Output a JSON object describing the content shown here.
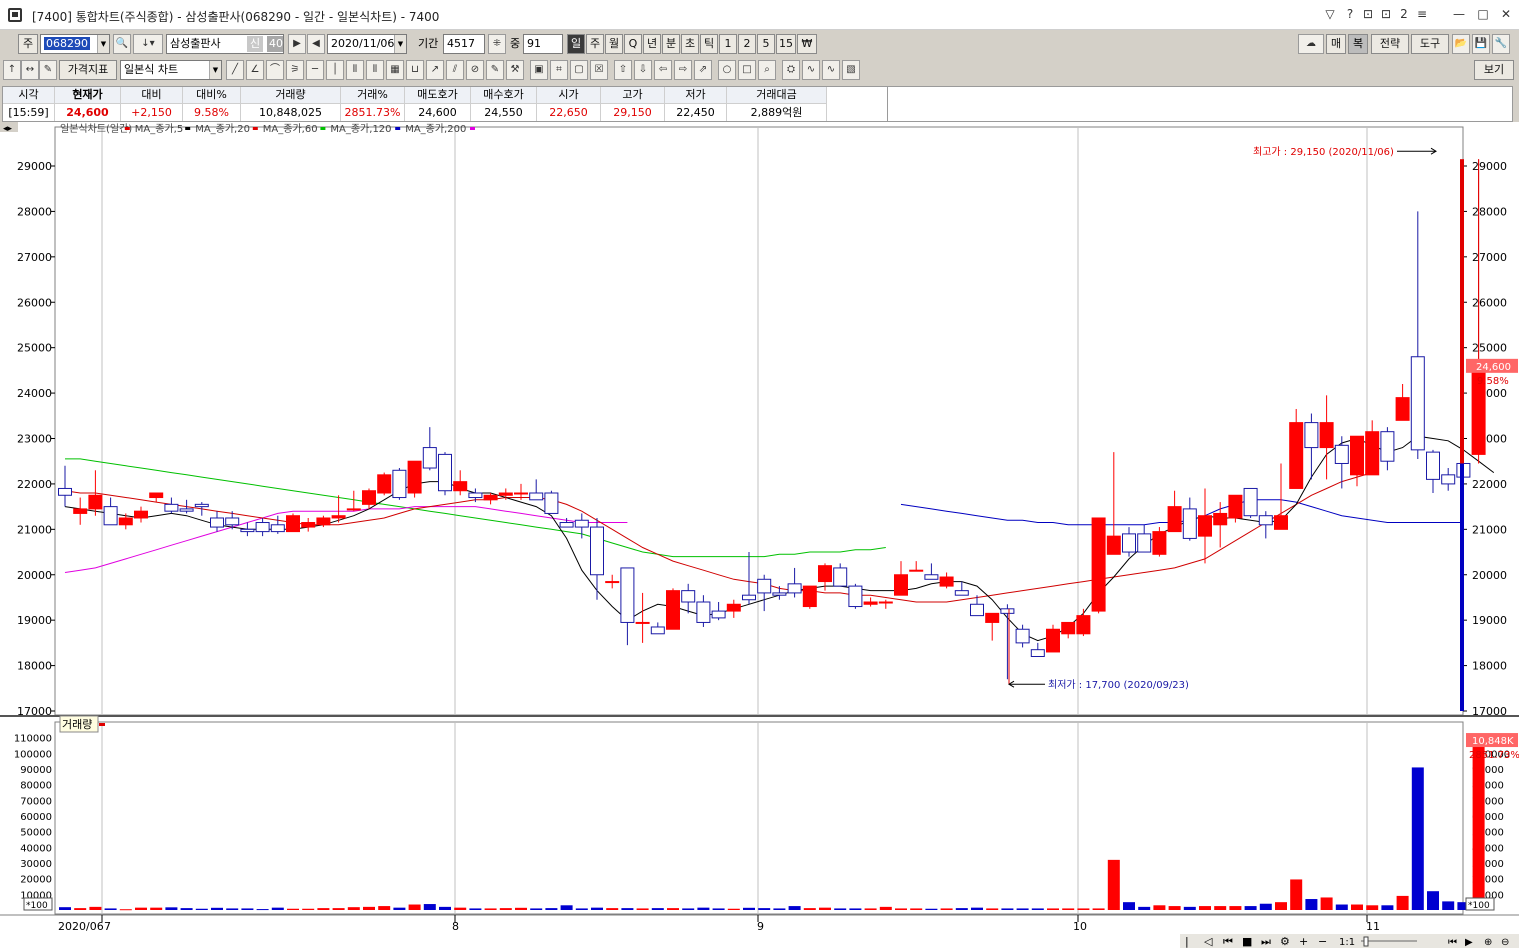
{
  "window": {
    "title": "[7400]  통합차트(주식종합) - 삼성출판사(068290 - 일간 - 일본식차트) - 7400",
    "buttons": [
      "▽",
      "?",
      "⊡",
      "⊡",
      "2",
      "≡",
      "—",
      "□",
      "✕"
    ]
  },
  "toolbar1": {
    "market_label": "주",
    "code": "068290",
    "name": "삼성출판사",
    "badge1": "신",
    "badge2": "40",
    "date": "2020/11/06",
    "period_label": "기간",
    "period_value": "4517",
    "middle_label": "중",
    "middle_value": "91",
    "periods": [
      "일",
      "주",
      "월",
      "Q",
      "년",
      "분",
      "초",
      "틱",
      "1",
      "2",
      "5",
      "15",
      "₩"
    ],
    "right_buttons": [
      "",
      "매",
      "복",
      "전략",
      "도구",
      "",
      "",
      ""
    ]
  },
  "toolbar2": {
    "indicator_label": "가격지표",
    "chart_type": "일본식 차트",
    "view_button": "보기"
  },
  "quote": {
    "columns": [
      {
        "head": "시각",
        "value": "[15:59]",
        "color": "#000000"
      },
      {
        "head": "현재가",
        "value": "24,600",
        "color": "#e00000"
      },
      {
        "head": "대비",
        "value": "+2,150",
        "color": "#e00000"
      },
      {
        "head": "대비%",
        "value": "9.58%",
        "color": "#e00000"
      },
      {
        "head": "거래량",
        "value": "10,848,025",
        "color": "#000000"
      },
      {
        "head": "거래%",
        "value": "2851.73%",
        "color": "#e00000"
      },
      {
        "head": "매도호가",
        "value": "24,600",
        "color": "#000000"
      },
      {
        "head": "매수호가",
        "value": "24,550",
        "color": "#000000"
      },
      {
        "head": "시가",
        "value": "22,650",
        "color": "#e00000"
      },
      {
        "head": "고가",
        "value": "29,150",
        "color": "#e00000"
      },
      {
        "head": "저가",
        "value": "22,450",
        "color": "#000000"
      },
      {
        "head": "거래대금",
        "value": "2,889억원",
        "color": "#000000"
      }
    ]
  },
  "chart_data": {
    "type": "candlestick",
    "legend": [
      "일본식차트(일간)",
      "MA_종가,5",
      "MA_종가,20",
      "MA_종가,60",
      "MA_종가,120",
      "MA_종가,200"
    ],
    "legend_colors": [
      "#e00000",
      "#000000",
      "#e00000",
      "#00c000",
      "#0000c0",
      "#e000e0"
    ],
    "price_axis": {
      "min": 17000,
      "max": 29000,
      "step": 1000,
      "ticks": [
        "29000",
        "28000",
        "27000",
        "26000",
        "25000",
        "24000",
        "23000",
        "22000",
        "21000",
        "20000",
        "19000",
        "18000",
        "17000"
      ]
    },
    "volume_label": "거래량",
    "volume_axis": {
      "ticks": [
        "110000",
        "100000",
        "90000",
        "80000",
        "70000",
        "60000",
        "50000",
        "40000",
        "30000",
        "20000",
        "10000"
      ],
      "unit": "*100"
    },
    "x_labels": [
      "2020/06",
      "7",
      "8",
      "9",
      "10",
      "11"
    ],
    "current_price_tag": "24,600",
    "current_pct_tag": "9.58%",
    "current_volume_tag": "10,848K",
    "current_volume_pct_tag": "2851.73%",
    "annotations": {
      "high": "최고가 : 29,150 (2020/11/06)",
      "low": "최저가 : 17,700 (2020/09/23)"
    },
    "candles": [
      {
        "o": 21900,
        "h": 22400,
        "l": 21500,
        "c": 21750
      },
      {
        "o": 21350,
        "h": 21700,
        "l": 21100,
        "c": 21450
      },
      {
        "o": 21450,
        "h": 22300,
        "l": 21300,
        "c": 21750
      },
      {
        "o": 21500,
        "h": 21700,
        "l": 21100,
        "c": 21100
      },
      {
        "o": 21100,
        "h": 21350,
        "l": 21000,
        "c": 21250
      },
      {
        "o": 21250,
        "h": 21500,
        "l": 21150,
        "c": 21400
      },
      {
        "o": 21700,
        "h": 21800,
        "l": 21600,
        "c": 21800
      },
      {
        "o": 21550,
        "h": 21700,
        "l": 21350,
        "c": 21400
      },
      {
        "o": 21450,
        "h": 21650,
        "l": 21350,
        "c": 21400
      },
      {
        "o": 21550,
        "h": 21600,
        "l": 21300,
        "c": 21500
      },
      {
        "o": 21250,
        "h": 21400,
        "l": 20950,
        "c": 21050
      },
      {
        "o": 21250,
        "h": 21400,
        "l": 21000,
        "c": 21100
      },
      {
        "o": 21000,
        "h": 21150,
        "l": 20850,
        "c": 20950
      },
      {
        "o": 21150,
        "h": 21250,
        "l": 20850,
        "c": 20950
      },
      {
        "o": 21100,
        "h": 21300,
        "l": 20900,
        "c": 20950
      },
      {
        "o": 20950,
        "h": 21350,
        "l": 20950,
        "c": 21300
      },
      {
        "o": 21050,
        "h": 21250,
        "l": 20950,
        "c": 21150
      },
      {
        "o": 21100,
        "h": 21300,
        "l": 21050,
        "c": 21250
      },
      {
        "o": 21250,
        "h": 21750,
        "l": 21150,
        "c": 21300
      },
      {
        "o": 21450,
        "h": 21850,
        "l": 21400,
        "c": 21450
      },
      {
        "o": 21550,
        "h": 21900,
        "l": 21450,
        "c": 21850
      },
      {
        "o": 21800,
        "h": 22250,
        "l": 21750,
        "c": 22200
      },
      {
        "o": 22300,
        "h": 22350,
        "l": 21650,
        "c": 21700
      },
      {
        "o": 21800,
        "h": 22500,
        "l": 21700,
        "c": 22500
      },
      {
        "o": 22800,
        "h": 23250,
        "l": 22300,
        "c": 22350
      },
      {
        "o": 22650,
        "h": 22700,
        "l": 21750,
        "c": 21850
      },
      {
        "o": 21850,
        "h": 22300,
        "l": 21750,
        "c": 22050
      },
      {
        "o": 21800,
        "h": 21900,
        "l": 21600,
        "c": 21700
      },
      {
        "o": 21650,
        "h": 21800,
        "l": 21550,
        "c": 21750
      },
      {
        "o": 21750,
        "h": 21900,
        "l": 21650,
        "c": 21800
      },
      {
        "o": 21800,
        "h": 22000,
        "l": 21650,
        "c": 21800
      },
      {
        "o": 21800,
        "h": 22100,
        "l": 21650,
        "c": 21650
      },
      {
        "o": 21800,
        "h": 21850,
        "l": 21350,
        "c": 21350
      },
      {
        "o": 21150,
        "h": 21250,
        "l": 21050,
        "c": 21050
      },
      {
        "o": 21200,
        "h": 21350,
        "l": 20800,
        "c": 21050
      },
      {
        "o": 21050,
        "h": 21250,
        "l": 19450,
        "c": 20000
      },
      {
        "o": 19850,
        "h": 20000,
        "l": 19700,
        "c": 19850
      },
      {
        "o": 20150,
        "h": 20150,
        "l": 18450,
        "c": 18950
      },
      {
        "o": 18950,
        "h": 19600,
        "l": 18500,
        "c": 18950
      },
      {
        "o": 18850,
        "h": 18950,
        "l": 18700,
        "c": 18700
      },
      {
        "o": 18800,
        "h": 19700,
        "l": 18800,
        "c": 19650
      },
      {
        "o": 19650,
        "h": 19800,
        "l": 19150,
        "c": 19400
      },
      {
        "o": 19400,
        "h": 19550,
        "l": 18850,
        "c": 18950
      },
      {
        "o": 19200,
        "h": 19400,
        "l": 19000,
        "c": 19050
      },
      {
        "o": 19200,
        "h": 19450,
        "l": 19050,
        "c": 19350
      },
      {
        "o": 19550,
        "h": 20500,
        "l": 19350,
        "c": 19450
      },
      {
        "o": 19900,
        "h": 20000,
        "l": 19200,
        "c": 19600
      },
      {
        "o": 19600,
        "h": 19750,
        "l": 19450,
        "c": 19550
      },
      {
        "o": 19800,
        "h": 20150,
        "l": 19500,
        "c": 19600
      },
      {
        "o": 19300,
        "h": 19700,
        "l": 19250,
        "c": 19750
      },
      {
        "o": 19850,
        "h": 20250,
        "l": 19650,
        "c": 20200
      },
      {
        "o": 20150,
        "h": 20250,
        "l": 19800,
        "c": 19750
      },
      {
        "o": 19750,
        "h": 19800,
        "l": 19250,
        "c": 19300
      },
      {
        "o": 19350,
        "h": 19500,
        "l": 19300,
        "c": 19400
      },
      {
        "o": 19400,
        "h": 19450,
        "l": 19250,
        "c": 19400
      },
      {
        "o": 19550,
        "h": 20300,
        "l": 19550,
        "c": 20000
      },
      {
        "o": 20100,
        "h": 20300,
        "l": 20100,
        "c": 20100
      },
      {
        "o": 20000,
        "h": 20250,
        "l": 19950,
        "c": 19900
      },
      {
        "o": 19750,
        "h": 20050,
        "l": 19700,
        "c": 19950
      },
      {
        "o": 19650,
        "h": 19850,
        "l": 19550,
        "c": 19550
      },
      {
        "o": 19350,
        "h": 19550,
        "l": 19100,
        "c": 19100
      },
      {
        "o": 18950,
        "h": 19050,
        "l": 18550,
        "c": 19150
      },
      {
        "o": 19250,
        "h": 19350,
        "l": 17700,
        "c": 19150
      },
      {
        "o": 18800,
        "h": 18900,
        "l": 18400,
        "c": 18500
      },
      {
        "o": 18350,
        "h": 18500,
        "l": 18200,
        "c": 18200
      },
      {
        "o": 18300,
        "h": 18900,
        "l": 18300,
        "c": 18800
      },
      {
        "o": 18700,
        "h": 18950,
        "l": 18600,
        "c": 18950
      },
      {
        "o": 18700,
        "h": 19250,
        "l": 18650,
        "c": 19100
      },
      {
        "o": 19200,
        "h": 20050,
        "l": 19150,
        "c": 21250
      },
      {
        "o": 20450,
        "h": 22700,
        "l": 20450,
        "c": 20850
      },
      {
        "o": 20900,
        "h": 21050,
        "l": 20400,
        "c": 20500
      },
      {
        "o": 20900,
        "h": 21100,
        "l": 20500,
        "c": 20500
      },
      {
        "o": 20450,
        "h": 21050,
        "l": 20400,
        "c": 20950
      },
      {
        "o": 20950,
        "h": 21850,
        "l": 20950,
        "c": 21500
      },
      {
        "o": 21450,
        "h": 21700,
        "l": 20750,
        "c": 20800
      },
      {
        "o": 20850,
        "h": 21900,
        "l": 20250,
        "c": 21300
      },
      {
        "o": 21100,
        "h": 21600,
        "l": 20600,
        "c": 21350
      },
      {
        "o": 21250,
        "h": 21700,
        "l": 21150,
        "c": 21750
      },
      {
        "o": 21900,
        "h": 21900,
        "l": 21250,
        "c": 21300
      },
      {
        "o": 21300,
        "h": 21400,
        "l": 20800,
        "c": 21100
      },
      {
        "o": 21000,
        "h": 22450,
        "l": 21000,
        "c": 21300
      },
      {
        "o": 21900,
        "h": 23650,
        "l": 21900,
        "c": 23350
      },
      {
        "o": 23350,
        "h": 23550,
        "l": 22100,
        "c": 22800
      },
      {
        "o": 22800,
        "h": 23950,
        "l": 22100,
        "c": 23350
      },
      {
        "o": 22850,
        "h": 23050,
        "l": 21900,
        "c": 22450
      },
      {
        "o": 22200,
        "h": 22850,
        "l": 21950,
        "c": 23050
      },
      {
        "o": 22200,
        "h": 23400,
        "l": 22200,
        "c": 23150
      },
      {
        "o": 23150,
        "h": 23250,
        "l": 22300,
        "c": 22500
      },
      {
        "o": 23400,
        "h": 24200,
        "l": 23400,
        "c": 23900
      },
      {
        "o": 24800,
        "h": 28000,
        "l": 22550,
        "c": 22750
      },
      {
        "o": 22700,
        "h": 22750,
        "l": 21800,
        "c": 22100
      },
      {
        "o": 22200,
        "h": 22350,
        "l": 21850,
        "c": 22000
      },
      {
        "o": 22450,
        "h": 22700,
        "l": 22000,
        "c": 22150
      },
      {
        "o": 22650,
        "h": 29150,
        "l": 22450,
        "c": 24600
      }
    ],
    "ma5": [
      21500,
      21450,
      21400,
      21350,
      21300,
      21250,
      21300,
      21350,
      21300,
      21200,
      21100,
      21050,
      21000,
      21000,
      21000,
      21000,
      21050,
      21100,
      21200,
      21300,
      21450,
      21650,
      21850,
      22000,
      22050,
      22050,
      21900,
      21800,
      21800,
      21700,
      21600,
      21500,
      21300,
      20800,
      20100,
      19650,
      19300,
      19000,
      19200,
      19350,
      19300,
      19200,
      19100,
      19150,
      19250,
      19350,
      19450,
      19550,
      19650,
      19700,
      19750,
      19750,
      19700,
      19650,
      19650,
      19650,
      19700,
      19800,
      19850,
      19850,
      19750,
      19450,
      19050,
      18700,
      18550,
      18650,
      18850,
      19150,
      19600,
      19950,
      20350,
      20650,
      20900,
      21050,
      21200,
      21300,
      21250,
      21250,
      21200,
      21150,
      21200,
      21550,
      22150,
      22650,
      22900,
      23000,
      22850,
      22700,
      22800,
      23050,
      23000,
      22950,
      22750,
      22500,
      22250
    ],
    "ma20": [
      21900,
      21850,
      21800,
      21750,
      21700,
      21650,
      21600,
      21550,
      21500,
      21450,
      21350,
      21300,
      21250,
      21200,
      21200,
      21200,
      21200,
      21250,
      21300,
      21400,
      21450,
      21500,
      21550,
      21600,
      21600,
      21600,
      21600,
      21600,
      21600,
      21550,
      21450,
      21300,
      21150,
      21000,
      20850,
      20700,
      20500,
      20350,
      20250,
      20150,
      20050,
      19950,
      19850,
      19800,
      19750,
      19700,
      19650,
      19600,
      19600,
      19600,
      19600,
      19600,
      19600,
      19600,
      19600,
      19600,
      19550,
      19500,
      19450,
      19400,
      19400,
      19400,
      19450,
      19500,
      19600,
      19700,
      19800,
      19950,
      20100,
      20200,
      20350,
      20450,
      20550,
      20700,
      20850,
      21050,
      21250,
      21450,
      21650,
      21800,
      21950,
      22100,
      22150,
      22200,
      22250
    ],
    "ma60": [
      21850,
      21800,
      21800,
      21750,
      21700,
      21650,
      21600,
      21550,
      21500,
      21450,
      21400,
      21350,
      21300,
      21250,
      21200,
      21150,
      21100,
      21100,
      21100,
      21150,
      21200,
      21250,
      21350,
      21450,
      21500,
      21550,
      21600,
      21650,
      21650,
      21700,
      21700,
      21700,
      21650,
      21550,
      21400,
      21200,
      21000,
      20800,
      20600,
      20450,
      20300,
      20200,
      20100,
      20000,
      19900,
      19850,
      19800,
      19700,
      19650,
      19650,
      19600,
      19600,
      19550,
      19550,
      19500,
      19450,
      19400,
      19400,
      19400,
      19450,
      19500,
      19550,
      19600,
      19650,
      19700,
      19750,
      19800,
      19850,
      19900,
      19950,
      20000,
      20050,
      20100,
      20150,
      20250,
      20350,
      20550,
      20750,
      20950,
      21150,
      21350,
      21550,
      21750,
      21900,
      22050,
      22150,
      22250
    ],
    "ma120": [
      22550,
      22550,
      22500,
      22450,
      22400,
      22350,
      22300,
      22250,
      22200,
      22150,
      22100,
      22050,
      22000,
      21950,
      21900,
      21850,
      21800,
      21750,
      21700,
      21650,
      21600,
      21550,
      21500,
      21450,
      21400,
      21350,
      21300,
      21250,
      21200,
      21150,
      21100,
      21050,
      21000,
      20950,
      20900,
      20800,
      20700,
      20600,
      20500,
      20450,
      20400,
      20400,
      20400,
      20400,
      20400,
      20400,
      20400,
      20450,
      20450,
      20500,
      20500,
      20500,
      20550,
      20550,
      20600
    ],
    "ma200": [
      21550,
      21500,
      21450,
      21400,
      21350,
      21300,
      21250,
      21200,
      21200,
      21150,
      21150,
      21100,
      21100,
      21100,
      21100,
      21100,
      21100,
      21150,
      21150,
      21200,
      21300,
      21450,
      21550,
      21650,
      21650,
      21650,
      21600,
      21500,
      21400,
      21300,
      21250,
      21200,
      21150,
      21150,
      21150,
      21150,
      21150,
      21150
    ],
    "ma_extra": [
      20050,
      20100,
      20150,
      20250,
      20350,
      20450,
      20550,
      20650,
      20750,
      20850,
      20950,
      21050,
      21150,
      21250,
      21350,
      21400,
      21400,
      21400,
      21400,
      21400,
      21450,
      21450,
      21450,
      21500,
      21500,
      21500,
      21500,
      21500,
      21450,
      21400,
      21350,
      21300,
      21250,
      21200,
      21150,
      21150,
      21150,
      21150
    ],
    "volumes": [
      1800,
      1200,
      2000,
      1000,
      500,
      1500,
      1500,
      1700,
      1200,
      800,
      1400,
      1000,
      1000,
      600,
      1500,
      800,
      800,
      1200,
      1200,
      1800,
      2000,
      2500,
      1500,
      3500,
      3800,
      2000,
      1500,
      1000,
      1000,
      1200,
      1400,
      1000,
      1200,
      3000,
      1000,
      1500,
      1200,
      1200,
      1000,
      1200,
      1200,
      1000,
      1500,
      1000,
      800,
      1400,
      1200,
      1000,
      2500,
      1200,
      1500,
      1000,
      1000,
      1000,
      2000,
      1000,
      1000,
      800,
      1000,
      1200,
      1500,
      1000,
      1000,
      1000,
      1000,
      1000,
      1000,
      1000,
      1000,
      32000,
      5000,
      2000,
      3000,
      2500,
      2000,
      2500,
      2500,
      2500,
      2500,
      4000,
      5000,
      19500,
      7000,
      8000,
      3500,
      3500,
      3000,
      3000,
      9000,
      91000,
      12000,
      5500,
      5000,
      108480
    ]
  },
  "bottom_bar": {
    "scale_label": "1:1",
    "icons": [
      "◁",
      "▶",
      "⏮",
      "■",
      "⏭",
      "⚙",
      "+",
      "−"
    ]
  }
}
